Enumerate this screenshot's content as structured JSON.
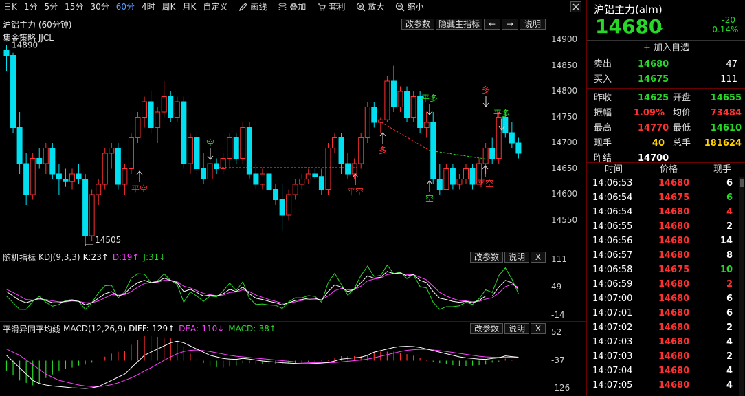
{
  "toolbar": {
    "periods": [
      "日K",
      "1分",
      "5分",
      "15分",
      "30分",
      "60分",
      "4时",
      "周K",
      "月K",
      "自定义"
    ],
    "active_period": "60分",
    "tools": [
      {
        "label": "画线",
        "icon": "pencil-icon"
      },
      {
        "label": "叠加",
        "icon": "stack-icon"
      },
      {
        "label": "套利",
        "icon": "cart-icon"
      },
      {
        "label": "放大",
        "icon": "zoom-in-icon"
      },
      {
        "label": "缩小",
        "icon": "zoom-out-icon"
      }
    ]
  },
  "main_chart": {
    "title": "沪铝主力 (60分钟)",
    "subtitle": "集金策略 JJCL",
    "buttons": {
      "params": "改参数",
      "hide": "隐藏主指标",
      "prev": "←",
      "next": "→",
      "help": "说明"
    },
    "axis": [
      "14900",
      "14850",
      "14800",
      "14750",
      "14700",
      "14650",
      "14600",
      "14550"
    ],
    "high_label": "14890",
    "low_label": "14505",
    "signals": [
      {
        "text": "平空",
        "color": "#ff3030"
      },
      {
        "text": "空",
        "color": "#28d828"
      },
      {
        "text": "多",
        "color": "#ff3030"
      },
      {
        "text": "平空",
        "color": "#ff3030"
      },
      {
        "text": "平多",
        "color": "#28d828"
      },
      {
        "text": "空",
        "color": "#28d828"
      },
      {
        "text": "多",
        "color": "#ff3030"
      },
      {
        "text": "平多",
        "color": "#28d828"
      },
      {
        "text": "平空",
        "color": "#ff3030"
      }
    ]
  },
  "kdj": {
    "name": "随机指标",
    "params": "KDJ(9,3,3)",
    "k": "K:23↑",
    "d": "D:19↑",
    "j": "J:31↓",
    "buttons": {
      "params": "改参数",
      "help": "说明",
      "close": "X"
    },
    "axis": [
      "111",
      "49",
      "-14"
    ]
  },
  "macd": {
    "name": "平滑异同平均线",
    "params": "MACD(12,26,9)",
    "diff": "DIFF:-129↑",
    "dea": "DEA:-110↓",
    "macd": "MACD:-38↑",
    "buttons": {
      "params": "改参数",
      "help": "说明",
      "close": "X"
    },
    "axis": [
      "52",
      "-37",
      "-126"
    ]
  },
  "quote": {
    "title": "沪铝主力(alm)",
    "price": "14680",
    "change": "-20",
    "change_pct": "-0.14%",
    "add_fav": "加入自选",
    "sell": {
      "label": "卖出",
      "price": "14680",
      "vol": "47"
    },
    "buy": {
      "label": "买入",
      "price": "14675",
      "vol": "111"
    },
    "stats": [
      [
        {
          "label": "昨收",
          "value": "14625",
          "color": "g"
        },
        {
          "label": "开盘",
          "value": "14655",
          "color": "g"
        }
      ],
      [
        {
          "label": "振幅",
          "value": "1.09%",
          "color": "r"
        },
        {
          "label": "均价",
          "value": "73484",
          "color": "r"
        }
      ],
      [
        {
          "label": "最高",
          "value": "14770",
          "color": "r"
        },
        {
          "label": "最低",
          "value": "14610",
          "color": "g"
        }
      ],
      [
        {
          "label": "现手",
          "value": "40",
          "color": "y"
        },
        {
          "label": "总手",
          "value": "181624",
          "color": "y"
        }
      ],
      [
        {
          "label": "昨结",
          "value": "14700",
          "color": "w"
        }
      ]
    ],
    "ticks_header": {
      "time": "时间",
      "price": "价格",
      "vol": "现手"
    },
    "ticks": [
      {
        "time": "14:06:53",
        "price": "14680",
        "pc": "r",
        "vol": "6",
        "vc": "w"
      },
      {
        "time": "14:06:54",
        "price": "14675",
        "pc": "r",
        "vol": "6",
        "vc": "g"
      },
      {
        "time": "14:06:54",
        "price": "14680",
        "pc": "r",
        "vol": "4",
        "vc": "r"
      },
      {
        "time": "14:06:55",
        "price": "14680",
        "pc": "r",
        "vol": "2",
        "vc": "w"
      },
      {
        "time": "14:06:56",
        "price": "14680",
        "pc": "r",
        "vol": "14",
        "vc": "w"
      },
      {
        "time": "14:06:57",
        "price": "14680",
        "pc": "r",
        "vol": "8",
        "vc": "w"
      },
      {
        "time": "14:06:58",
        "price": "14675",
        "pc": "r",
        "vol": "10",
        "vc": "g"
      },
      {
        "time": "14:06:59",
        "price": "14680",
        "pc": "r",
        "vol": "2",
        "vc": "r"
      },
      {
        "time": "14:07:00",
        "price": "14680",
        "pc": "r",
        "vol": "6",
        "vc": "w"
      },
      {
        "time": "14:07:01",
        "price": "14680",
        "pc": "r",
        "vol": "6",
        "vc": "w"
      },
      {
        "time": "14:07:02",
        "price": "14680",
        "pc": "r",
        "vol": "2",
        "vc": "w"
      },
      {
        "time": "14:07:03",
        "price": "14680",
        "pc": "r",
        "vol": "4",
        "vc": "w"
      },
      {
        "time": "14:07:03",
        "price": "14680",
        "pc": "r",
        "vol": "2",
        "vc": "w"
      },
      {
        "time": "14:07:04",
        "price": "14680",
        "pc": "r",
        "vol": "4",
        "vc": "w"
      },
      {
        "time": "14:07:05",
        "price": "14680",
        "pc": "r",
        "vol": "4",
        "vc": "w"
      }
    ]
  },
  "colors": {
    "up": "#ff3030",
    "down": "#00e0f0",
    "green": "#28d828",
    "magenta": "#ff40ff",
    "yellow": "#ffd200",
    "border": "#6a0000"
  },
  "chart_data": {
    "type": "candlestick",
    "candles": [
      [
        14880,
        14890,
        14840,
        14870
      ],
      [
        14870,
        14875,
        14720,
        14730
      ],
      [
        14730,
        14760,
        14640,
        14660
      ],
      [
        14660,
        14680,
        14580,
        14600
      ],
      [
        14600,
        14680,
        14590,
        14670
      ],
      [
        14670,
        14690,
        14650,
        14660
      ],
      [
        14660,
        14700,
        14640,
        14690
      ],
      [
        14690,
        14700,
        14630,
        14640
      ],
      [
        14640,
        14660,
        14600,
        14630
      ],
      [
        14630,
        14650,
        14615,
        14625
      ],
      [
        14625,
        14650,
        14610,
        14640
      ],
      [
        14640,
        14660,
        14620,
        14630
      ],
      [
        14630,
        14640,
        14500,
        14520
      ],
      [
        14520,
        14610,
        14510,
        14600
      ],
      [
        14600,
        14630,
        14580,
        14620
      ],
      [
        14620,
        14690,
        14610,
        14680
      ],
      [
        14680,
        14700,
        14650,
        14690
      ],
      [
        14690,
        14700,
        14610,
        14620
      ],
      [
        14620,
        14660,
        14600,
        14650
      ],
      [
        14650,
        14720,
        14640,
        14710
      ],
      [
        14710,
        14760,
        14700,
        14750
      ],
      [
        14750,
        14790,
        14730,
        14780
      ],
      [
        14780,
        14800,
        14720,
        14730
      ],
      [
        14730,
        14770,
        14700,
        14760
      ],
      [
        14760,
        14820,
        14750,
        14790
      ],
      [
        14790,
        14800,
        14740,
        14750
      ],
      [
        14750,
        14790,
        14740,
        14780
      ],
      [
        14780,
        14790,
        14650,
        14660
      ],
      [
        14660,
        14720,
        14640,
        14710
      ],
      [
        14710,
        14720,
        14640,
        14650
      ],
      [
        14650,
        14680,
        14620,
        14630
      ],
      [
        14630,
        14670,
        14620,
        14660
      ],
      [
        14660,
        14670,
        14640,
        14650
      ],
      [
        14650,
        14680,
        14640,
        14670
      ],
      [
        14670,
        14720,
        14650,
        14710
      ],
      [
        14710,
        14720,
        14660,
        14670
      ],
      [
        14670,
        14740,
        14660,
        14730
      ],
      [
        14730,
        14740,
        14630,
        14640
      ],
      [
        14640,
        14660,
        14610,
        14620
      ],
      [
        14620,
        14650,
        14610,
        14640
      ],
      [
        14640,
        14650,
        14600,
        14610
      ],
      [
        14610,
        14620,
        14580,
        14590
      ],
      [
        14590,
        14620,
        14530,
        14560
      ],
      [
        14560,
        14610,
        14550,
        14600
      ],
      [
        14600,
        14630,
        14590,
        14620
      ],
      [
        14620,
        14640,
        14610,
        14630
      ],
      [
        14630,
        14650,
        14620,
        14640
      ],
      [
        14640,
        14650,
        14630,
        14635
      ],
      [
        14635,
        14650,
        14600,
        14610
      ],
      [
        14610,
        14700,
        14600,
        14690
      ],
      [
        14690,
        14720,
        14680,
        14710
      ],
      [
        14710,
        14720,
        14640,
        14660
      ],
      [
        14660,
        14680,
        14630,
        14640
      ],
      [
        14640,
        14670,
        14630,
        14660
      ],
      [
        14660,
        14720,
        14650,
        14710
      ],
      [
        14710,
        14780,
        14700,
        14770
      ],
      [
        14770,
        14780,
        14730,
        14740
      ],
      [
        14740,
        14750,
        14720,
        14745
      ],
      [
        14745,
        14830,
        14740,
        14820
      ],
      [
        14820,
        14850,
        14760,
        14770
      ],
      [
        14770,
        14810,
        14760,
        14800
      ],
      [
        14800,
        14810,
        14740,
        14750
      ],
      [
        14750,
        14800,
        14740,
        14790
      ],
      [
        14790,
        14800,
        14720,
        14730
      ],
      [
        14730,
        14760,
        14710,
        14740
      ],
      [
        14740,
        14760,
        14620,
        14630
      ],
      [
        14630,
        14660,
        14600,
        14610
      ],
      [
        14610,
        14660,
        14610,
        14650
      ],
      [
        14650,
        14660,
        14610,
        14620
      ],
      [
        14620,
        14640,
        14610,
        14630
      ],
      [
        14630,
        14660,
        14620,
        14650
      ],
      [
        14650,
        14660,
        14610,
        14620
      ],
      [
        14620,
        14670,
        14620,
        14660
      ],
      [
        14660,
        14700,
        14640,
        14690
      ],
      [
        14690,
        14710,
        14660,
        14670
      ],
      [
        14670,
        14760,
        14660,
        14750
      ],
      [
        14750,
        14760,
        14710,
        14720
      ],
      [
        14720,
        14740,
        14690,
        14700
      ],
      [
        14700,
        14710,
        14670,
        14680
      ]
    ],
    "kdj_k": [
      40,
      30,
      20,
      15,
      20,
      25,
      20,
      15,
      15,
      18,
      20,
      18,
      10,
      15,
      25,
      35,
      40,
      30,
      35,
      50,
      60,
      65,
      60,
      62,
      70,
      65,
      60,
      40,
      45,
      38,
      30,
      32,
      30,
      35,
      45,
      40,
      50,
      35,
      25,
      22,
      18,
      15,
      10,
      15,
      20,
      22,
      25,
      25,
      20,
      40,
      55,
      50,
      40,
      45,
      60,
      75,
      70,
      72,
      85,
      80,
      82,
      75,
      78,
      65,
      60,
      40,
      25,
      22,
      18,
      16,
      18,
      15,
      20,
      30,
      30,
      50,
      65,
      60,
      45
    ],
    "kdj_d": [
      45,
      38,
      30,
      22,
      21,
      23,
      22,
      19,
      17,
      17,
      19,
      18,
      15,
      15,
      19,
      26,
      33,
      32,
      33,
      40,
      50,
      58,
      60,
      61,
      65,
      65,
      62,
      52,
      48,
      42,
      36,
      33,
      31,
      32,
      38,
      39,
      44,
      40,
      32,
      27,
      22,
      18,
      14,
      14,
      17,
      20,
      22,
      23,
      22,
      30,
      42,
      47,
      44,
      44,
      52,
      64,
      68,
      70,
      78,
      80,
      81,
      78,
      78,
      72,
      66,
      52,
      38,
      30,
      24,
      20,
      19,
      17,
      18,
      23,
      26,
      37,
      51,
      56,
      50
    ],
    "kdj_j": [
      30,
      15,
      0,
      0,
      18,
      29,
      16,
      7,
      11,
      20,
      22,
      18,
      0,
      15,
      37,
      53,
      54,
      26,
      39,
      70,
      80,
      79,
      60,
      64,
      80,
      65,
      56,
      16,
      39,
      30,
      18,
      30,
      28,
      41,
      59,
      42,
      62,
      25,
      11,
      12,
      10,
      9,
      2,
      17,
      26,
      26,
      31,
      29,
      16,
      60,
      81,
      56,
      32,
      47,
      76,
      97,
      74,
      76,
      99,
      80,
      84,
      69,
      78,
      51,
      48,
      16,
      0,
      6,
      6,
      8,
      16,
      11,
      24,
      44,
      38,
      76,
      93,
      68,
      35
    ],
    "macd_diff": [
      -20,
      -40,
      -60,
      -80,
      -100,
      -110,
      -115,
      -118,
      -120,
      -122,
      -124,
      -125,
      -126,
      -124,
      -120,
      -110,
      -100,
      -90,
      -80,
      -60,
      -40,
      -20,
      -10,
      0,
      10,
      20,
      25,
      20,
      10,
      0,
      -10,
      -20,
      -25,
      -30,
      -32,
      -33,
      -30,
      -32,
      -35,
      -38,
      -40,
      -42,
      -44,
      -45,
      -46,
      -47,
      -47,
      -46,
      -45,
      -43,
      -38,
      -32,
      -30,
      -28,
      -26,
      -20,
      -10,
      -5,
      0,
      5,
      8,
      9,
      8,
      5,
      0,
      -5,
      -10,
      -15,
      -20,
      -25,
      -28,
      -30,
      -32,
      -33,
      -30,
      -28,
      -22,
      -24,
      -26
    ],
    "macd_dea": [
      0,
      -10,
      -20,
      -35,
      -50,
      -65,
      -80,
      -90,
      -100,
      -105,
      -110,
      -115,
      -118,
      -120,
      -120,
      -118,
      -114,
      -108,
      -100,
      -92,
      -82,
      -70,
      -60,
      -48,
      -36,
      -25,
      -15,
      -8,
      -4,
      -3,
      -5,
      -8,
      -12,
      -16,
      -20,
      -23,
      -25,
      -27,
      -29,
      -31,
      -33,
      -35,
      -37,
      -39,
      -41,
      -42,
      -43,
      -44,
      -44,
      -44,
      -43,
      -41,
      -39,
      -37,
      -35,
      -32,
      -28,
      -23,
      -18,
      -13,
      -8,
      -4,
      -2,
      -1,
      -1,
      -3,
      -5,
      -8,
      -11,
      -14,
      -17,
      -20,
      -23,
      -25,
      -26,
      -26,
      -26,
      -26,
      -26
    ]
  }
}
